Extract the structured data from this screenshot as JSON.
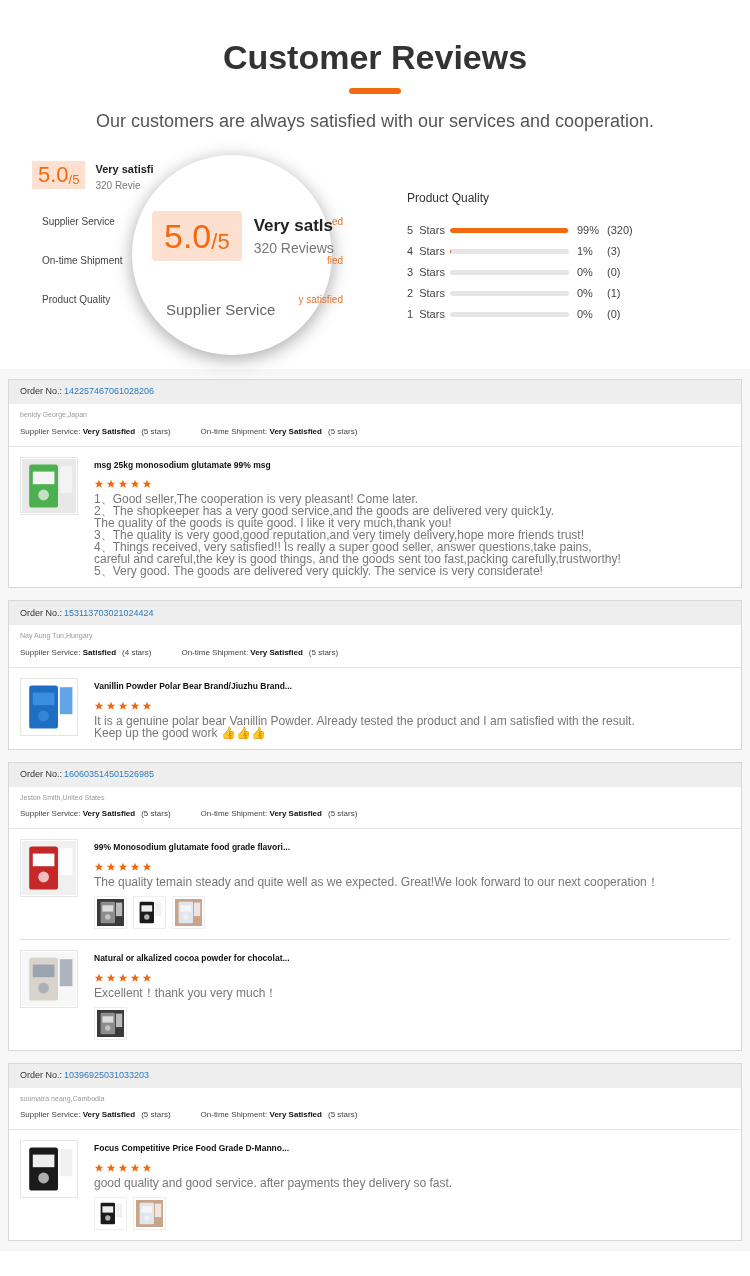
{
  "heading": "Customer Reviews",
  "subtitle": "Our customers are always satisfied with our services and cooperation.",
  "summary": {
    "score": "5.0",
    "out_of": "/5",
    "verdict": "Very satisfi",
    "reviews": "320 Revie",
    "rows": [
      {
        "label": "Supplier Service",
        "value": "ed"
      },
      {
        "label": "On-time Shipment",
        "value": "fied"
      },
      {
        "label": "Product Quality",
        "value": "y satisfied"
      }
    ]
  },
  "magnifier": {
    "score": "5.0",
    "out_of": "/5",
    "verdict": "Very satls",
    "reviews": "320 Reviews",
    "label": "Supplier Service"
  },
  "quality": {
    "title": "Product Quality",
    "bars": [
      {
        "label": "5  Stars",
        "level": 0.99,
        "percent": "99%",
        "count": "(320)"
      },
      {
        "label": "4  Stars",
        "level": 0.01,
        "percent": "1%",
        "count": "(3)"
      },
      {
        "label": "3  Stars",
        "level": 0,
        "percent": "0%",
        "count": "(0)"
      },
      {
        "label": "2  Stars",
        "level": 0,
        "percent": "0%",
        "count": "(1)"
      },
      {
        "label": "1  Stars",
        "level": 0,
        "percent": "0%",
        "count": "(0)"
      }
    ]
  },
  "reviews": [
    {
      "order_label": "Order No.:",
      "order_no": "142257467061028206",
      "reviewer": "benidy George,Japan",
      "ratings": [
        {
          "label": "Supplier Service:",
          "value": "Very Satisfied",
          "stars_text": "(5 stars)"
        },
        {
          "label": "On-time Shipment:",
          "value": "Very Satisfied",
          "stars_text": "(5 stars)"
        }
      ],
      "items": [
        {
          "title": "msg 25kg monosodium glutamate 99% msg",
          "stars": 5,
          "comment": [
            "1、Good seller,The cooperation is very pleasant! Come later.",
            "2、The shopkeeper has a very good service,and the goods are delivered very quick1y.",
            "The quality of the goods is quite good. I like it very much,thank you!",
            "3、The quality is very good,good reputation,and very timely delivery,hope more friends trust!",
            "4、Things received, very satisfied!! Is really a super good seller,  answer questions,take pains,",
            "careful and careful,the key is good things, and the goods sent too fast,packing carefully,trustworthy!",
            "5、Very good. The goods are delivered very quickly. The service is very considerate!"
          ]
        }
      ]
    },
    {
      "order_label": "Order No.:",
      "order_no": "153113703021024424",
      "reviewer": "Nay Aung Tun,Hungary",
      "ratings": [
        {
          "label": "Supplier Service:",
          "value": "Satisfied",
          "stars_text": "(4 stars)"
        },
        {
          "label": "On-time Shipment:",
          "value": "Very Satisfied",
          "stars_text": "(5 stars)"
        }
      ],
      "items": [
        {
          "title": "Vanillin Powder Polar Bear Brand/Jiuzhu Brand...",
          "stars": 5,
          "comment": [
            "It is a genuine polar bear Vanillin Powder. Already tested the product and I am satisfied with the result.",
            "Keep up the good work 👍👍👍"
          ]
        }
      ]
    },
    {
      "order_label": "Order No.:",
      "order_no": "160603514501526985",
      "reviewer": "Jeston Smith,United States",
      "ratings": [
        {
          "label": "Supplier Service:",
          "value": "Very Satisfied",
          "stars_text": "(5 stars)"
        },
        {
          "label": "On-time Shipment:",
          "value": "Very Satisfied",
          "stars_text": "(5 stars)"
        }
      ],
      "items": [
        {
          "title": "99% Monosodium glutamate food grade flavori...",
          "stars": 5,
          "comment": [
            "The quality temain steady and quite well as we expected. Great!We look forward to our next cooperation！"
          ],
          "photos": [
            {
              "kind": "picture"
            },
            {
              "kind": "picture"
            },
            {
              "kind": "picture"
            }
          ]
        },
        {
          "title": "Natural or alkalized cocoa powder for chocolat...",
          "stars": 5,
          "comment": [
            "Excellent！thank you very much！"
          ],
          "photos": [
            {
              "kind": "picture"
            }
          ]
        }
      ]
    },
    {
      "order_label": "Order No.:",
      "order_no": "10396925031033203",
      "reviewer": "soumatra neang,Cambodia",
      "ratings": [
        {
          "label": "Supplier Service:",
          "value": "Very Satisfied",
          "stars_text": "(5 stars)"
        },
        {
          "label": "On-time Shipment:",
          "value": "Very Satisfied",
          "stars_text": "(5 stars)"
        }
      ],
      "items": [
        {
          "title": "Focus Competitive Price Food Grade D-Manno...",
          "stars": 5,
          "comment": [
            "good quality and good service. after payments they delivery so fast."
          ],
          "photos": [
            {
              "kind": "picture"
            },
            {
              "kind": "picture"
            }
          ]
        }
      ]
    }
  ]
}
